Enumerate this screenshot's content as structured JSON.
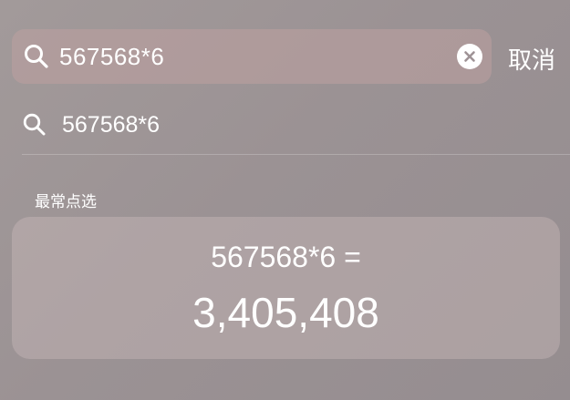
{
  "search": {
    "query": "567568*6",
    "cancel_label": "取消"
  },
  "suggestion": {
    "text": "567568*6"
  },
  "section": {
    "label": "最常点选"
  },
  "result_card": {
    "expression": "567568*6 =",
    "result": "3,405,408"
  },
  "icons": {
    "search": "search-icon",
    "clear": "clear-icon"
  }
}
